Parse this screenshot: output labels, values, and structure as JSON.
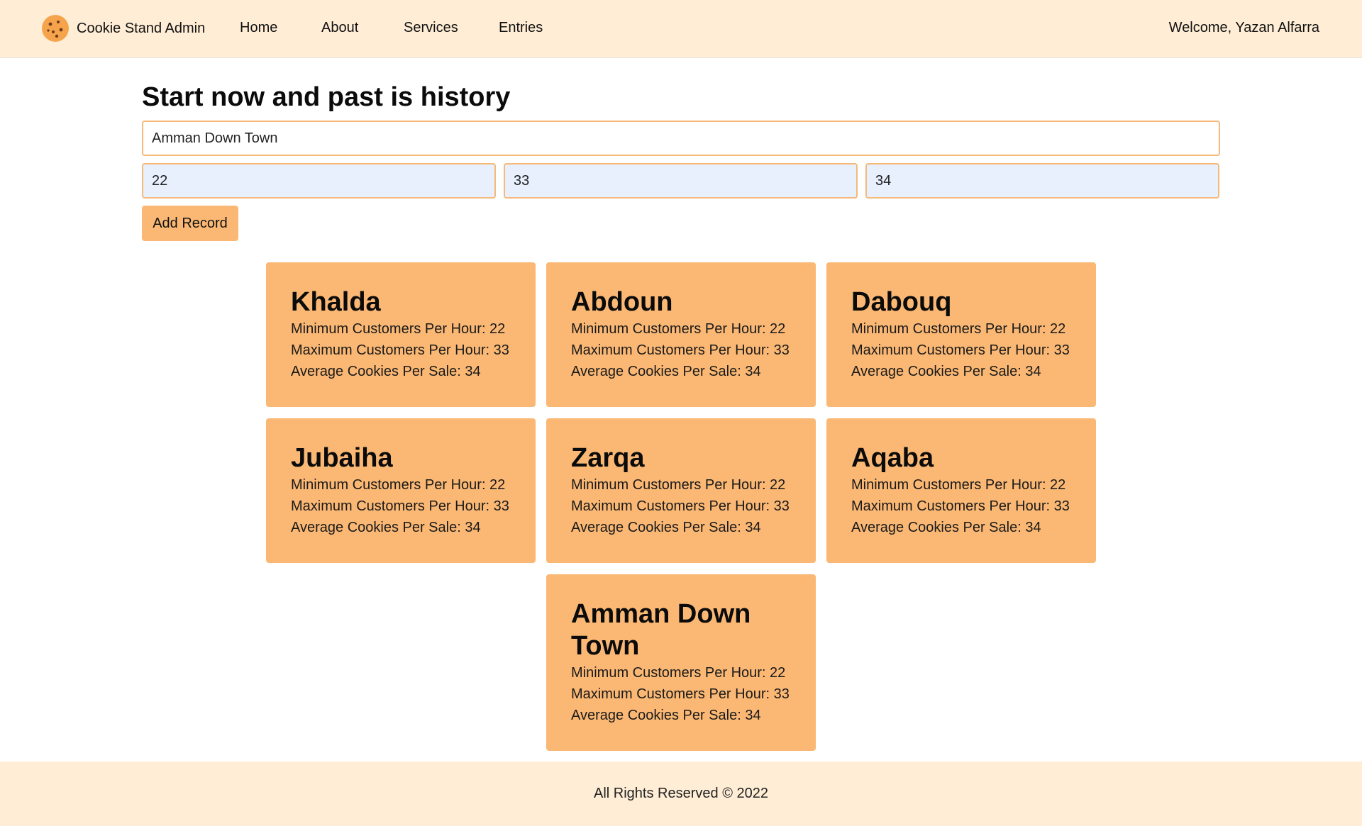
{
  "header": {
    "brand": "Cookie Stand Admin",
    "nav": [
      "Home",
      "About",
      "Services",
      "Entries"
    ],
    "welcome": "Welcome, Yazan Alfarra",
    "logo_icon": "cookie-icon"
  },
  "form": {
    "title": "Start now and past is history",
    "location_value": "Amman Down Town",
    "min_value": "22",
    "max_value": "33",
    "avg_value": "34",
    "button_label": "Add Record"
  },
  "stands": [
    {
      "name": "Khalda",
      "min": "Minimum Customers Per Hour: 22",
      "max": "Maximum Customers Per Hour: 33",
      "avg": "Average Cookies Per Sale: 34"
    },
    {
      "name": "Abdoun",
      "min": "Minimum Customers Per Hour: 22",
      "max": "Maximum Customers Per Hour: 33",
      "avg": "Average Cookies Per Sale: 34"
    },
    {
      "name": "Dabouq",
      "min": "Minimum Customers Per Hour: 22",
      "max": "Maximum Customers Per Hour: 33",
      "avg": "Average Cookies Per Sale: 34"
    },
    {
      "name": "Jubaiha",
      "min": "Minimum Customers Per Hour: 22",
      "max": "Maximum Customers Per Hour: 33",
      "avg": "Average Cookies Per Sale: 34"
    },
    {
      "name": "Zarqa",
      "min": "Minimum Customers Per Hour: 22",
      "max": "Maximum Customers Per Hour: 33",
      "avg": "Average Cookies Per Sale: 34"
    },
    {
      "name": "Aqaba",
      "min": "Minimum Customers Per Hour: 22",
      "max": "Maximum Customers Per Hour: 33",
      "avg": "Average Cookies Per Sale: 34"
    },
    {
      "name": "Amman Down Town",
      "min": "Minimum Customers Per Hour: 22",
      "max": "Maximum Customers Per Hour: 33",
      "avg": "Average Cookies Per Sale: 34"
    }
  ],
  "footer": {
    "text": "All Rights Reserved © 2022"
  },
  "colors": {
    "header_bg": "#ffedd5",
    "card_bg": "#fbb874",
    "input_border": "#f5b97a",
    "autofill_bg": "#e8f0fe"
  }
}
